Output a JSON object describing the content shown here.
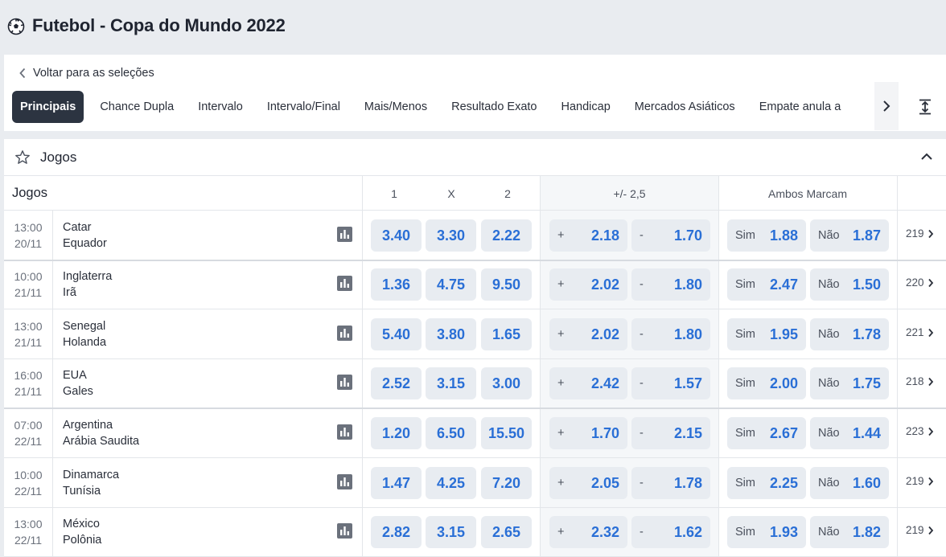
{
  "header": {
    "title": "Futebol - Copa do Mundo 2022",
    "icon": "soccer-ball-icon"
  },
  "nav": {
    "back_label": "Voltar para as seleções",
    "tabs": [
      {
        "label": "Principais",
        "active": true
      },
      {
        "label": "Chance Dupla"
      },
      {
        "label": "Intervalo"
      },
      {
        "label": "Intervalo/Final"
      },
      {
        "label": "Mais/Menos"
      },
      {
        "label": "Resultado Exato"
      },
      {
        "label": "Handicap"
      },
      {
        "label": "Mercados Asiáticos"
      },
      {
        "label": "Empate anula a"
      }
    ]
  },
  "section": {
    "title": "Jogos"
  },
  "columns": {
    "games": "Jogos",
    "home": "1",
    "draw": "X",
    "away": "2",
    "over_under": "+/- 2,5",
    "btts": "Ambos Marcam"
  },
  "labels": {
    "over": "+",
    "under": "-",
    "yes": "Sim",
    "no": "Não"
  },
  "matches": [
    {
      "time": "13:00",
      "date": "20/11",
      "home": "Catar",
      "away": "Equador",
      "odds": [
        "3.40",
        "3.30",
        "2.22"
      ],
      "over": "2.18",
      "under": "1.70",
      "yes": "1.88",
      "no": "1.87",
      "more": "219"
    },
    {
      "time": "10:00",
      "date": "21/11",
      "home": "Inglaterra",
      "away": "Irã",
      "odds": [
        "1.36",
        "4.75",
        "9.50"
      ],
      "over": "2.02",
      "under": "1.80",
      "yes": "2.47",
      "no": "1.50",
      "more": "220"
    },
    {
      "time": "13:00",
      "date": "21/11",
      "home": "Senegal",
      "away": "Holanda",
      "odds": [
        "5.40",
        "3.80",
        "1.65"
      ],
      "over": "2.02",
      "under": "1.80",
      "yes": "1.95",
      "no": "1.78",
      "more": "221"
    },
    {
      "time": "16:00",
      "date": "21/11",
      "home": "EUA",
      "away": "Gales",
      "odds": [
        "2.52",
        "3.15",
        "3.00"
      ],
      "over": "2.42",
      "under": "1.57",
      "yes": "2.00",
      "no": "1.75",
      "more": "218"
    },
    {
      "time": "07:00",
      "date": "22/11",
      "home": "Argentina",
      "away": "Arábia Saudita",
      "odds": [
        "1.20",
        "6.50",
        "15.50"
      ],
      "over": "1.70",
      "under": "2.15",
      "yes": "2.67",
      "no": "1.44",
      "more": "223"
    },
    {
      "time": "10:00",
      "date": "22/11",
      "home": "Dinamarca",
      "away": "Tunísia",
      "odds": [
        "1.47",
        "4.25",
        "7.20"
      ],
      "over": "2.05",
      "under": "1.78",
      "yes": "2.25",
      "no": "1.60",
      "more": "219"
    },
    {
      "time": "13:00",
      "date": "22/11",
      "home": "México",
      "away": "Polônia",
      "odds": [
        "2.82",
        "3.15",
        "2.65"
      ],
      "over": "2.32",
      "under": "1.62",
      "yes": "1.93",
      "no": "1.82",
      "more": "219"
    }
  ],
  "colors": {
    "accent": "#2a6fd6",
    "active_tab": "#2c3441",
    "odd_bg": "#e8ecf1"
  }
}
